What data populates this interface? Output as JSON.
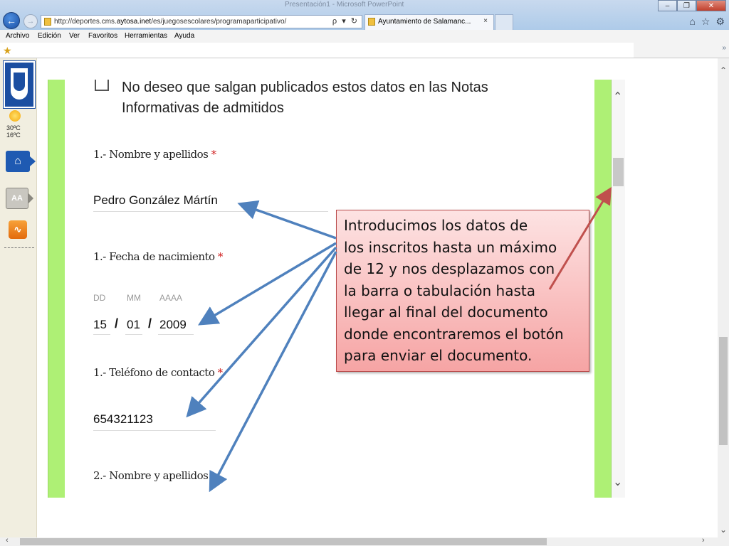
{
  "browser": {
    "window_title": "Presentación1 - Microsoft PowerPoint",
    "url_prefix": "http://deportes.cms.",
    "url_domain": "aytosa.inet",
    "url_path": "/es/juegosescolares/programaparticipativo/",
    "address_tools": "ρ ▾ ↻",
    "tab_title": "Ayuntamiento de Salamanc...",
    "tab_close": "×",
    "menu": [
      "Archivo",
      "Edición",
      "Ver",
      "Favoritos",
      "Herramientas",
      "Ayuda"
    ],
    "fav_more": "»",
    "icons": [
      "back-arrow-icon",
      "forward-arrow-icon",
      "home-icon",
      "star-icon",
      "gear-icon"
    ]
  },
  "sidebar": {
    "temp_high": "30ºC",
    "temp_low": "16ºC",
    "aa_label": "AA",
    "icons": [
      "coat-of-arms-icon",
      "sun-icon",
      "home-icon",
      "text-size-icon",
      "rss-icon"
    ]
  },
  "form": {
    "checkbox_text": "No deseo que salgan publicados estos datos en las Notas Informativas de admitidos",
    "q1_name_label": "1.- Nombre y apellidos",
    "q1_name_value": "Pedro González Mártín",
    "q1_birth_label": "1.- Fecha de nacimiento",
    "dd_label": "DD",
    "mm_label": "MM",
    "aaaa_label": "AAAA",
    "dd_value": "15",
    "mm_value": "01",
    "aaaa_value": "2009",
    "date_sep": "/",
    "q1_phone_label": "1.- Teléfono de contacto",
    "q1_phone_value": "654321123",
    "q2_name_label": "2.- Nombre y apellidos",
    "required_mark": "*"
  },
  "callout": {
    "text": "Introducimos los datos de\nlos inscritos hasta un máximo\nde 12 y nos desplazamos con\nla barra o tabulación hasta\nllegar al final del documento\ndonde encontraremos el botón\npara enviar el documento."
  },
  "colors": {
    "green_band": "#aef075",
    "arrow_blue": "#4f81bd",
    "arrow_red": "#c0504d",
    "callout_border": "#b94a4a"
  }
}
